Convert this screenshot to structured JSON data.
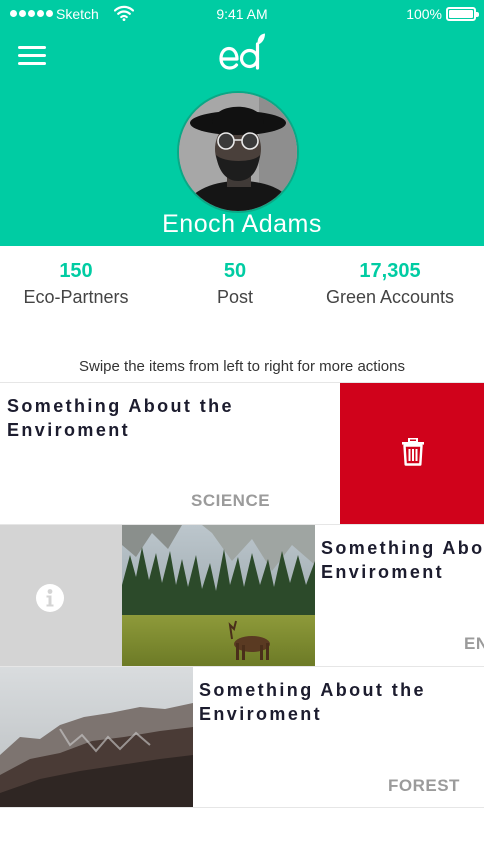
{
  "status_bar": {
    "carrier": "Sketch",
    "time": "9:41 AM",
    "battery": "100%"
  },
  "profile": {
    "name": "Enoch Adams"
  },
  "stats": [
    {
      "value": "150",
      "label": "Eco-Partners"
    },
    {
      "value": "50",
      "label": "Post"
    },
    {
      "value": "17,305",
      "label": "Green Accounts"
    }
  ],
  "hint": "Swipe the items from left to right for more actions",
  "cards": [
    {
      "title_line1": "Something About the",
      "title_line2": "Enviroment",
      "category": "SCIENCE",
      "action": "trash-icon"
    },
    {
      "title_line1": "Something About the",
      "title_line2": "Enviroment",
      "category": "ENVIRONMENT",
      "action": "info-icon"
    },
    {
      "title_line1": "Something About the",
      "title_line2": "Enviroment",
      "category": "FOREST"
    }
  ],
  "colors": {
    "brand": "#00cca3",
    "delete": "#d0021b",
    "info": "#d4d4d4",
    "category": "#9b9b9b"
  }
}
